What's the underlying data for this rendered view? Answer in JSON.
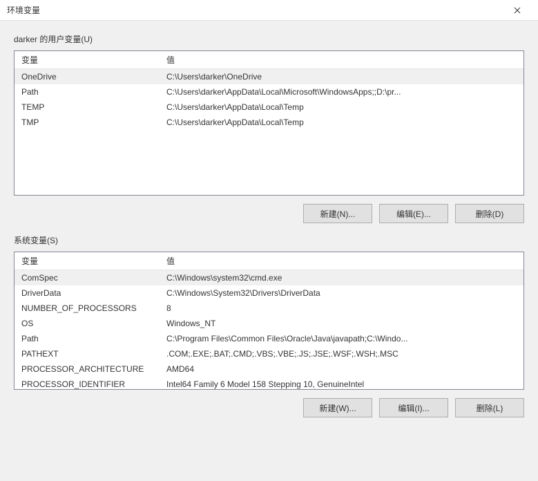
{
  "window": {
    "title": "环境变量"
  },
  "user_section": {
    "label": "darker 的用户变量(U)",
    "columns": {
      "name": "变量",
      "value": "值"
    },
    "rows": [
      {
        "name": "OneDrive",
        "value": "C:\\Users\\darker\\OneDrive"
      },
      {
        "name": "Path",
        "value": "C:\\Users\\darker\\AppData\\Local\\Microsoft\\WindowsApps;;D:\\pr..."
      },
      {
        "name": "TEMP",
        "value": "C:\\Users\\darker\\AppData\\Local\\Temp"
      },
      {
        "name": "TMP",
        "value": "C:\\Users\\darker\\AppData\\Local\\Temp"
      }
    ],
    "buttons": {
      "new": "新建(N)...",
      "edit": "编辑(E)...",
      "delete": "删除(D)"
    }
  },
  "system_section": {
    "label": "系统变量(S)",
    "columns": {
      "name": "变量",
      "value": "值"
    },
    "rows": [
      {
        "name": "ComSpec",
        "value": "C:\\Windows\\system32\\cmd.exe"
      },
      {
        "name": "DriverData",
        "value": "C:\\Windows\\System32\\Drivers\\DriverData"
      },
      {
        "name": "NUMBER_OF_PROCESSORS",
        "value": "8"
      },
      {
        "name": "OS",
        "value": "Windows_NT"
      },
      {
        "name": "Path",
        "value": "C:\\Program Files\\Common Files\\Oracle\\Java\\javapath;C:\\Windo..."
      },
      {
        "name": "PATHEXT",
        "value": ".COM;.EXE;.BAT;.CMD;.VBS;.VBE;.JS;.JSE;.WSF;.WSH;.MSC"
      },
      {
        "name": "PROCESSOR_ARCHITECTURE",
        "value": "AMD64"
      },
      {
        "name": "PROCESSOR_IDENTIFIER",
        "value": "Intel64 Family 6 Model 158 Stepping 10, GenuineIntel"
      }
    ],
    "buttons": {
      "new": "新建(W)...",
      "edit": "编辑(I)...",
      "delete": "删除(L)"
    }
  }
}
